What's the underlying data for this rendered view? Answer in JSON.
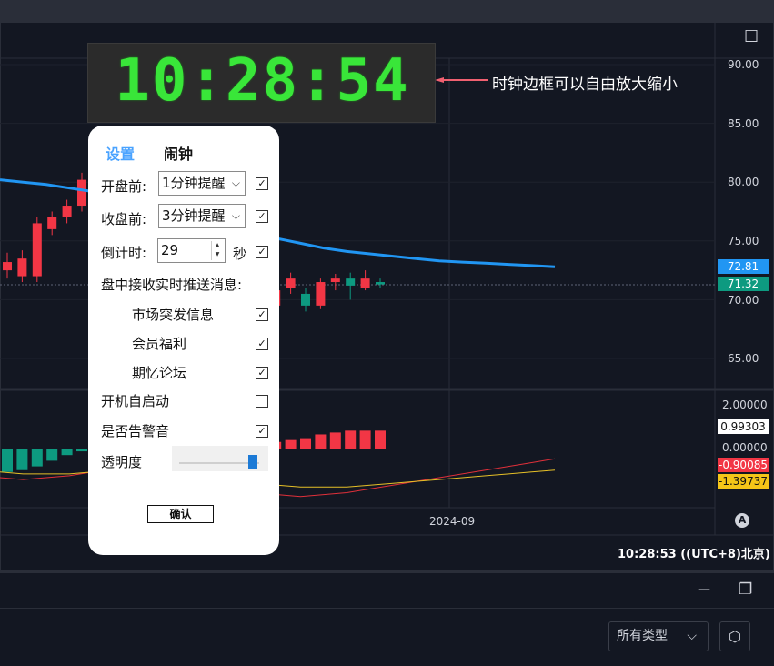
{
  "clock": {
    "time": "10:28:54"
  },
  "annotation": {
    "text": "时钟边框可以自由放大缩小"
  },
  "dialog": {
    "tabs": [
      "设置",
      "闹钟"
    ],
    "pre_open_label": "开盘前:",
    "pre_open_value": "1分钟提醒",
    "pre_close_label": "收盘前:",
    "pre_close_value": "3分钟提醒",
    "countdown_label": "倒计时:",
    "countdown_value": "29",
    "countdown_unit": "秒",
    "push_label": "盘中接收实时推送消息:",
    "push_items": [
      "市场突发信息",
      "会员福利",
      "期忆论坛"
    ],
    "autostart_label": "开机自启动",
    "alarm_sound_label": "是否告警音",
    "opacity_label": "透明度",
    "opacity_level": 0.95,
    "confirm_label": "确认",
    "check_glyph": "✓",
    "chevron": "⌵",
    "spin_up": "▲",
    "spin_down": "▼"
  },
  "axis": {
    "price_ticks": [
      "90.00",
      "85.00",
      "80.00",
      "75.00",
      "70.00",
      "65.00"
    ],
    "price_badge_blue": "72.81",
    "price_badge_green": "71.32",
    "macd_ticks": [
      "2.00000",
      "0.00000"
    ],
    "macd_badge_white": "0.99303",
    "macd_badge_red": "-0.90085",
    "macd_badge_yellow": "-1.39737",
    "time_tick": "2024-09",
    "auto_label": "A"
  },
  "status": {
    "time": "10:28:53 ((UTC+8)北京)"
  },
  "footer": {
    "filter_value": "所有类型",
    "filter_chevron": "⌵",
    "settings_icon": "⬡"
  },
  "icons": {
    "maximize": "☐",
    "minimize": "—",
    "restore": "❐"
  },
  "chart_data": {
    "type": "line",
    "candles": [
      {
        "o": 72.5,
        "c": 73.2,
        "h": 74.0,
        "l": 71.8
      },
      {
        "o": 72.0,
        "c": 73.5,
        "h": 74.2,
        "l": 71.5
      },
      {
        "o": 72.0,
        "c": 76.5,
        "h": 77.0,
        "l": 71.5
      },
      {
        "o": 76.0,
        "c": 77.0,
        "h": 77.5,
        "l": 75.5
      },
      {
        "o": 77.0,
        "c": 78.0,
        "h": 78.5,
        "l": 76.5
      },
      {
        "o": 78.0,
        "c": 80.2,
        "h": 80.8,
        "l": 77.5
      },
      {
        "o": 75.8,
        "c": 73.5,
        "h": 76.5,
        "l": 73.0
      },
      {
        "o": 74.0,
        "c": 72.5,
        "h": 74.5,
        "l": 72.0
      },
      {
        "o": 73.5,
        "c": 70.2,
        "h": 74.2,
        "l": 69.8
      },
      {
        "o": 70.5,
        "c": 69.5,
        "h": 71.0,
        "l": 69.0
      },
      {
        "o": 69.8,
        "c": 70.5,
        "h": 71.5,
        "l": 69.0
      },
      {
        "o": 70.2,
        "c": 68.8,
        "h": 70.8,
        "l": 68.5
      },
      {
        "o": 69.0,
        "c": 67.8,
        "h": 69.5,
        "l": 67.0
      },
      {
        "o": 67.8,
        "c": 68.5,
        "h": 69.2,
        "l": 67.0
      },
      {
        "o": 68.5,
        "c": 65.8,
        "h": 69.0,
        "l": 65.2
      },
      {
        "o": 65.8,
        "c": 66.8,
        "h": 67.5,
        "l": 65.5
      },
      {
        "o": 67.0,
        "c": 69.0,
        "h": 69.5,
        "l": 66.8
      },
      {
        "o": 69.0,
        "c": 69.2,
        "h": 70.5,
        "l": 68.5
      },
      {
        "o": 69.5,
        "c": 70.8,
        "h": 71.2,
        "l": 69.0
      },
      {
        "o": 71.0,
        "c": 71.8,
        "h": 72.3,
        "l": 70.5
      },
      {
        "o": 70.5,
        "c": 69.5,
        "h": 71.0,
        "l": 69.0
      },
      {
        "o": 69.5,
        "c": 71.5,
        "h": 71.8,
        "l": 69.2
      },
      {
        "o": 71.5,
        "c": 71.8,
        "h": 72.2,
        "l": 70.8
      },
      {
        "o": 71.8,
        "c": 71.2,
        "h": 72.3,
        "l": 70.0
      },
      {
        "o": 71.0,
        "c": 71.8,
        "h": 72.5,
        "l": 70.8
      },
      {
        "o": 71.5,
        "c": 71.3,
        "h": 71.8,
        "l": 71.0
      }
    ],
    "ma": [
      80.2,
      80.0,
      79.8,
      79.5,
      79.2,
      78.8,
      78.2,
      77.6,
      77.0,
      76.5,
      76.0,
      75.6,
      75.2,
      74.8,
      74.4,
      74.1,
      73.9,
      73.7,
      73.5,
      73.3,
      73.2,
      73.1,
      73.0,
      72.9,
      72.8
    ],
    "macd_hist": [
      -1.2,
      -1.1,
      -0.9,
      -0.6,
      -0.3,
      -0.1,
      -0.3,
      -0.6,
      -0.8,
      -1.0,
      -1.1,
      -1.2,
      -1.2,
      -1.1,
      -0.9,
      -0.6,
      -0.3,
      0.0,
      0.4,
      0.5,
      0.6,
      0.8,
      0.9,
      1.0,
      1.0,
      1.0
    ],
    "dif": [
      -1.5,
      -1.6,
      -1.5,
      -1.4,
      -1.2,
      -1.0,
      -1.2,
      -1.4,
      -1.6,
      -1.8,
      -2.0,
      -2.2,
      -2.4,
      -2.5,
      -2.4,
      -2.3,
      -2.1,
      -1.9,
      -1.7,
      -1.5,
      -1.3,
      -1.1,
      -0.9,
      -0.7,
      -0.5
    ],
    "dea": [
      -1.2,
      -1.3,
      -1.3,
      -1.3,
      -1.2,
      -1.1,
      -1.1,
      -1.2,
      -1.3,
      -1.4,
      -1.6,
      -1.7,
      -1.9,
      -2.0,
      -2.0,
      -2.0,
      -1.9,
      -1.8,
      -1.7,
      -1.6,
      -1.5,
      -1.4,
      -1.3,
      -1.2,
      -1.1
    ],
    "ylim": [
      62,
      92
    ],
    "macd_ylim": [
      -3,
      3
    ]
  }
}
